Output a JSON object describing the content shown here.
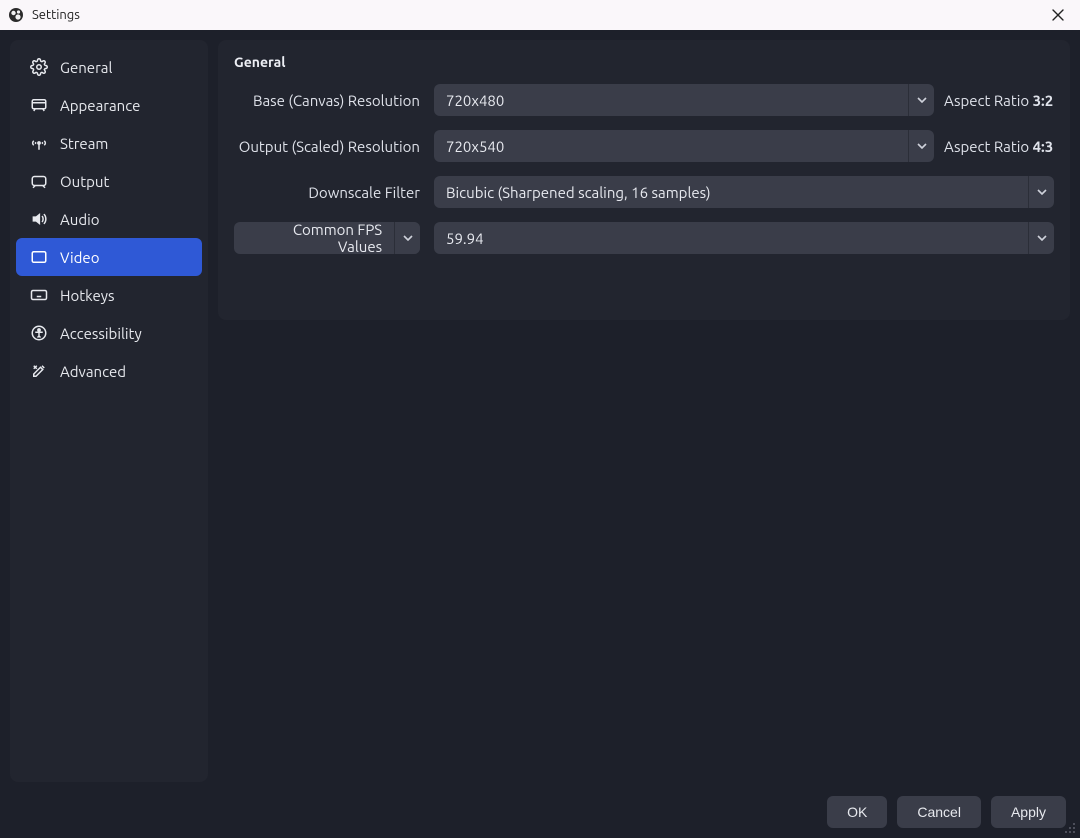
{
  "window": {
    "title": "Settings"
  },
  "sidebar": {
    "items": [
      {
        "label": "General"
      },
      {
        "label": "Appearance"
      },
      {
        "label": "Stream"
      },
      {
        "label": "Output"
      },
      {
        "label": "Audio"
      },
      {
        "label": "Video"
      },
      {
        "label": "Hotkeys"
      },
      {
        "label": "Accessibility"
      },
      {
        "label": "Advanced"
      }
    ],
    "active_index": 5
  },
  "main": {
    "section_title": "General",
    "base_res": {
      "label": "Base (Canvas) Resolution",
      "value": "720x480",
      "aspect_prefix": "Aspect Ratio ",
      "aspect_value": "3:2"
    },
    "output_res": {
      "label": "Output (Scaled) Resolution",
      "value": "720x540",
      "aspect_prefix": "Aspect Ratio ",
      "aspect_value": "4:3"
    },
    "downscale": {
      "label": "Downscale Filter",
      "value": "Bicubic (Sharpened scaling, 16 samples)"
    },
    "fps": {
      "type_label": "Common FPS Values",
      "value": "59.94"
    }
  },
  "buttons": {
    "ok": "OK",
    "cancel": "Cancel",
    "apply": "Apply"
  }
}
